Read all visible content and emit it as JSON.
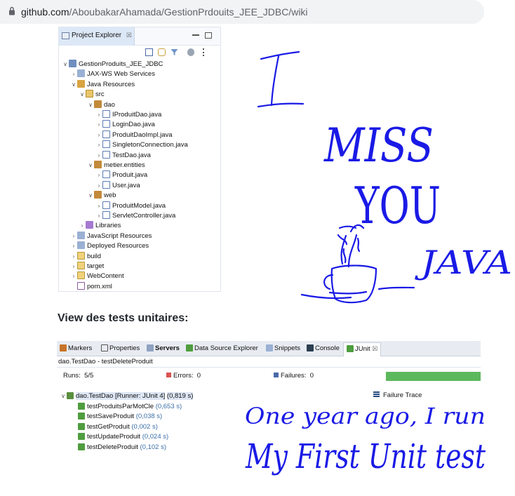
{
  "browser": {
    "url_host": "github.com",
    "url_path": "/AboubakarAhamada/GestionPrdouits_JEE_JDBC/wiki"
  },
  "project_explorer": {
    "tab_label": "Project Explorer",
    "tab_close": "☒",
    "tree": [
      {
        "label": "GestionProduits_JEE_JDBC",
        "twisty": "∨",
        "icon": "project",
        "depth": 0
      },
      {
        "label": "JAX-WS Web Services",
        "twisty": "›",
        "icon": "webservice",
        "depth": 1
      },
      {
        "label": "Java Resources",
        "twisty": "∨",
        "icon": "java-resources",
        "depth": 1
      },
      {
        "label": "src",
        "twisty": "∨",
        "icon": "source-folder",
        "depth": 2
      },
      {
        "label": "dao",
        "twisty": "∨",
        "icon": "package",
        "depth": 3
      },
      {
        "label": "IProduitDao.java",
        "twisty": "›",
        "icon": "java-file",
        "depth": 4
      },
      {
        "label": "LoginDao.java",
        "twisty": "›",
        "icon": "java-file",
        "depth": 4
      },
      {
        "label": "ProduitDaoImpl.java",
        "twisty": "›",
        "icon": "java-file",
        "depth": 4
      },
      {
        "label": "SingletonConnection.java",
        "twisty": "›",
        "icon": "java-file",
        "depth": 4
      },
      {
        "label": "TestDao.java",
        "twisty": "›",
        "icon": "java-file",
        "depth": 4
      },
      {
        "label": "metier.entities",
        "twisty": "∨",
        "icon": "package",
        "depth": 3
      },
      {
        "label": "Produit.java",
        "twisty": "›",
        "icon": "java-file",
        "depth": 4
      },
      {
        "label": "User.java",
        "twisty": "›",
        "icon": "java-file",
        "depth": 4
      },
      {
        "label": "web",
        "twisty": "∨",
        "icon": "package",
        "depth": 3
      },
      {
        "label": "ProduitModel.java",
        "twisty": "›",
        "icon": "java-file",
        "depth": 4
      },
      {
        "label": "ServletController.java",
        "twisty": "›",
        "icon": "java-file",
        "depth": 4
      },
      {
        "label": "Libraries",
        "twisty": "›",
        "icon": "libraries",
        "depth": 2
      },
      {
        "label": "JavaScript Resources",
        "twisty": "›",
        "icon": "js-resources",
        "depth": 1
      },
      {
        "label": "Deployed Resources",
        "twisty": "›",
        "icon": "deployed",
        "depth": 1
      },
      {
        "label": "build",
        "twisty": "›",
        "icon": "folder",
        "depth": 1
      },
      {
        "label": "target",
        "twisty": "›",
        "icon": "folder",
        "depth": 1
      },
      {
        "label": "WebContent",
        "twisty": "›",
        "icon": "folder",
        "depth": 1
      },
      {
        "label": "pom.xml",
        "twisty": "",
        "icon": "xml-file",
        "depth": 1
      }
    ]
  },
  "page": {
    "heading": "View des tests unitaires:"
  },
  "junit": {
    "tabs": [
      "Markers",
      "Properties",
      "Servers",
      "Data Source Explorer",
      "Snippets",
      "Console",
      "JUnit"
    ],
    "active_tab": "JUnit",
    "tab_close": "☒",
    "subtitle": "dao.TestDao - testDeleteProduit",
    "runs_label": "Runs:",
    "runs_value": "5/5",
    "errors_label": "Errors:",
    "errors_value": "0",
    "failures_label": "Failures:",
    "failures_value": "0",
    "progress_color": "#5cb85c",
    "progress": 1.0,
    "suite": {
      "name": "dao.TestDao [Runner: JUnit 4]",
      "time": "(0,819 s)"
    },
    "tests": [
      {
        "name": "testProduitsParMotCle",
        "time": "(0,653 s)"
      },
      {
        "name": "testSaveProduit",
        "time": "(0,038 s)"
      },
      {
        "name": "testGetProduit",
        "time": "(0,002 s)"
      },
      {
        "name": "testUpdateProduit",
        "time": "(0,024 s)"
      },
      {
        "name": "testDeleteProduit",
        "time": "(0,102 s)"
      }
    ],
    "failure_trace_label": "Failure Trace"
  },
  "handwriting": {
    "ink_color": "#1a1ae6",
    "line1": "I",
    "line2": "MISS",
    "line3": "YOU",
    "line4": "JAVA",
    "line5": "One year ago, I run",
    "line6": "My First Unit test"
  }
}
